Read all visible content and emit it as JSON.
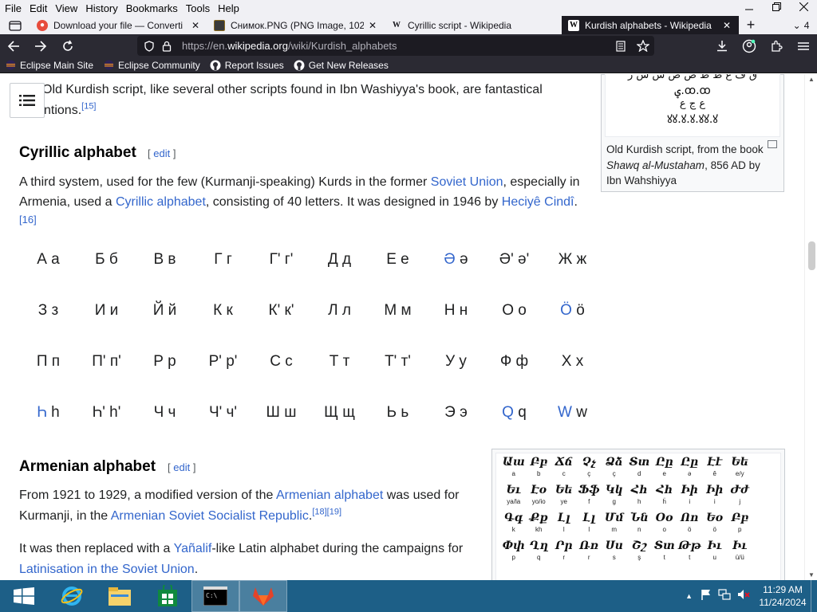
{
  "menubar": {
    "items": [
      "File",
      "Edit",
      "View",
      "History",
      "Bookmarks",
      "Tools",
      "Help"
    ]
  },
  "tabs": [
    {
      "title": "Download your file — Converti",
      "icon": "convertio-icon",
      "color": "#e74c3c"
    },
    {
      "title": "Снимок.PNG (PNG Image, 102€",
      "icon": "image-icon",
      "color": "#8a6a1e"
    },
    {
      "title": "Cyrillic script - Wikipedia",
      "icon": "wikipedia-icon",
      "color": "#ffffff"
    },
    {
      "title": "Kurdish alphabets - Wikipedia",
      "icon": "wikipedia-icon",
      "color": "#ffffff",
      "active": true
    }
  ],
  "tab_overflow_count": "4",
  "urlbar": {
    "prefix": "https://en.",
    "domain": "wikipedia.org",
    "path": "/wiki/Kurdish_alphabets"
  },
  "bookmarks": [
    {
      "label": "Eclipse Main Site",
      "icon": "eclipse-icon"
    },
    {
      "label": "Eclipse Community",
      "icon": "eclipse-icon"
    },
    {
      "label": "Report Issues",
      "icon": "github-icon"
    },
    {
      "label": "Get New Releases",
      "icon": "github-icon"
    }
  ],
  "article": {
    "top_para_line1": "Old Kurdish script, like several other scripts found in Ibn Washiyya's book, are fantastical",
    "top_para_line2": "ntions.",
    "top_para_ref": "[15]",
    "cyrillic_heading": "Cyrillic alphabet",
    "edit_open": "[ ",
    "edit_label": "edit",
    "edit_close": " ]",
    "cyr_p1": "A third system, used for the few (Kurmanji-speaking) Kurds in the former ",
    "cyr_link1": "Soviet Union",
    "cyr_p2": ", especially in",
    "cyr_p3": "Armenia, used a ",
    "cyr_link2": "Cyrillic alphabet",
    "cyr_p4": ", consisting of 40 letters. It was designed in 1946 by ",
    "cyr_link3": "Heciyê Cindî",
    "cyr_p5": ".",
    "cyr_ref": "[16]",
    "armenian_heading": "Armenian alphabet",
    "arm_p1": "From 1921 to 1929, a modified version of the ",
    "arm_link1": "Armenian alphabet",
    "arm_p2": " was used for",
    "arm_p3": "Kurmanji, in the ",
    "arm_link2": "Armenian Soviet Socialist Republic",
    "arm_p4": ".",
    "arm_ref1": "[18]",
    "arm_ref2": "[19]",
    "arm_p5": "It was then replaced with a ",
    "arm_link3": "Yañalif",
    "arm_p6": "-like Latin alphabet during the campaigns for",
    "arm_link4": "Latinisation in the Soviet Union",
    "arm_p7": "."
  },
  "cyrillic_letters": [
    [
      "А а",
      "Б б",
      "В в",
      "Г г",
      "Г' г'",
      "Д д",
      "Е е",
      "Ә ә",
      "Ә' ә'",
      "Ж ж"
    ],
    [
      "З з",
      "И и",
      "Й й",
      "К к",
      "К' к'",
      "Л л",
      "М м",
      "Н н",
      "О о",
      "Ö ö"
    ],
    [
      "П п",
      "П' п'",
      "Р р",
      "Р' р'",
      "С с",
      "Т т",
      "Т' т'",
      "У у",
      "Ф ф",
      "Х х"
    ],
    [
      "Һ h",
      "Һ' h'",
      "Ч ч",
      "Ч' ч'",
      "Ш ш",
      "Щ щ",
      "Ь ь",
      "Э э",
      "Q q",
      "W w"
    ]
  ],
  "old_kurdish_figure": {
    "caption_1": "Old Kurdish script, from the book ",
    "caption_italic": "Shawq al-Mustaham",
    "caption_2": ", 856 AD by Ibn Wahshiyya",
    "script_line1": "ق ف ع ظ ط ض ص ش س ر",
    "script_line2": "ؠ.ꝏ.ꝏ",
    "script_line3": "ع ڃ ع",
    "script_line4": "ꙋꙋ.ꙋ.ꙋ.ꙋꙋ.ꙋ"
  },
  "armenian_figure": {
    "rows": [
      {
        "big": [
          "Աա",
          "Բբ",
          "Ճճ",
          "Չչ",
          "Ձձ",
          "Տտ",
          "Ըը",
          "Ըը",
          "Էէ",
          "Եե"
        ],
        "small": [
          "a",
          "b",
          "c",
          "ç",
          "ç",
          "d",
          "e",
          "ə",
          "ê",
          "e/y"
        ]
      },
      {
        "big": [
          "Եւ",
          "Էо",
          "Եե",
          "Ֆֆ",
          "Կկ",
          "Հհ",
          "Հհ",
          "Իի",
          "Իի",
          "Ժժ"
        ],
        "small": [
          "ya/la",
          "yo/io",
          "ye",
          "f",
          "g",
          "h",
          "ḧ",
          "i",
          "i",
          "j"
        ]
      },
      {
        "big": [
          "Գգ",
          "Քք",
          "Լլ",
          "Լլ",
          "Մմ",
          "Նն",
          "Օօ",
          "Ոո",
          "Եօ",
          "Բբ"
        ],
        "small": [
          "k",
          "kh",
          "l",
          "l",
          "m",
          "n",
          "o",
          "ö",
          "ö",
          "p"
        ]
      },
      {
        "big": [
          "Փփ",
          "Ղղ",
          "Րր",
          "Ռռ",
          "Սս",
          "Շշ",
          "Տտ",
          "Թթ",
          "Իւ",
          "Իւ"
        ],
        "small": [
          "p",
          "q",
          "r",
          "r",
          "s",
          "ş",
          "t",
          "t",
          "u",
          "ü/ü"
        ]
      }
    ]
  },
  "taskbar": {
    "time": "11:29 AM",
    "date": "11/24/2024"
  },
  "colors": {
    "link": "#3366cc",
    "taskbar": "#1d5f87",
    "toolbar_dark": "#2b2a33"
  }
}
